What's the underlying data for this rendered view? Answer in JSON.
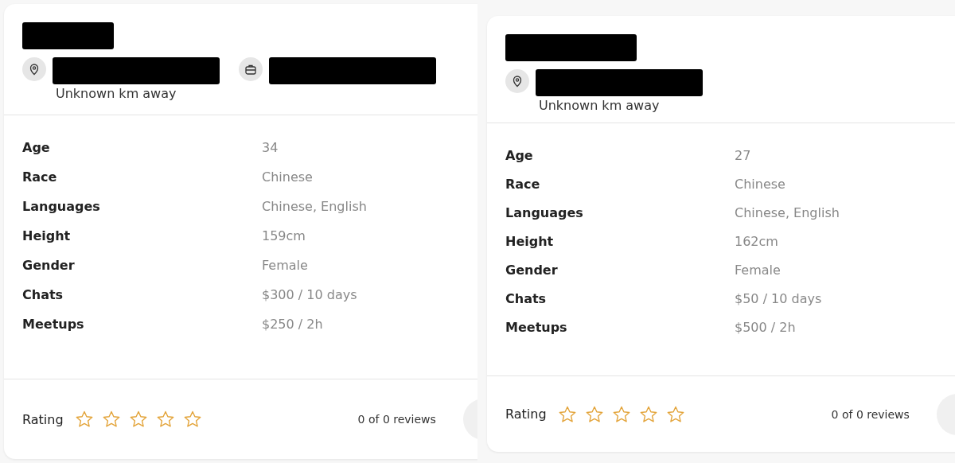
{
  "cards": [
    {
      "chips": [
        {
          "kind": "location",
          "note": "Unknown km away"
        },
        {
          "kind": "work"
        }
      ],
      "details": [
        {
          "label": "Age",
          "value": "34"
        },
        {
          "label": "Race",
          "value": "Chinese"
        },
        {
          "label": "Languages",
          "value": "Chinese, English"
        },
        {
          "label": "Height",
          "value": "159cm"
        },
        {
          "label": "Gender",
          "value": "Female"
        },
        {
          "label": "Chats",
          "value": "$300 / 10 days"
        },
        {
          "label": "Meetups",
          "value": "$250 / 2h"
        }
      ],
      "rating": {
        "label": "Rating",
        "stars": 0,
        "reviews": "0 of 0 reviews"
      }
    },
    {
      "chips": [
        {
          "kind": "location",
          "note": "Unknown km away"
        }
      ],
      "details": [
        {
          "label": "Age",
          "value": "27"
        },
        {
          "label": "Race",
          "value": "Chinese"
        },
        {
          "label": "Languages",
          "value": "Chinese, English"
        },
        {
          "label": "Height",
          "value": "162cm"
        },
        {
          "label": "Gender",
          "value": "Female"
        },
        {
          "label": "Chats",
          "value": "$50 / 10 days"
        },
        {
          "label": "Meetups",
          "value": "$500 / 2h"
        }
      ],
      "rating": {
        "label": "Rating",
        "stars": 0,
        "reviews": "0 of 0 reviews"
      }
    }
  ]
}
